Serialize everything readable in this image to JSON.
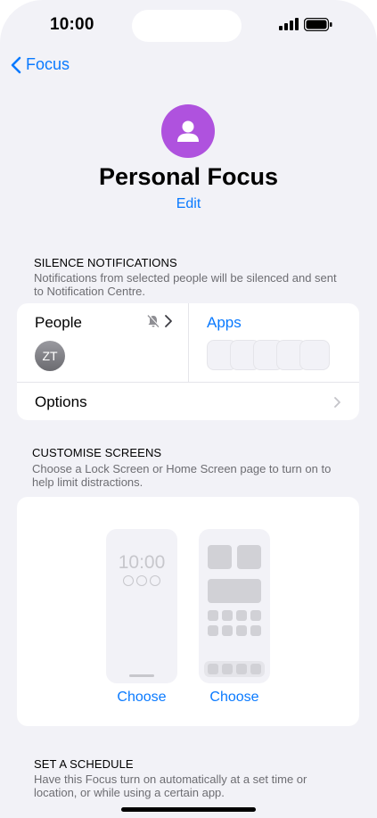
{
  "status_bar": {
    "time": "10:00"
  },
  "nav": {
    "back_label": "Focus"
  },
  "focus": {
    "title": "Personal Focus",
    "edit_label": "Edit",
    "icon_color": "#af52de"
  },
  "silence": {
    "header": "SILENCE NOTIFICATIONS",
    "description": "Notifications from selected people will be silenced and sent to Notification Centre.",
    "people_label": "People",
    "avatar_initials": "ZT",
    "apps_label": "Apps",
    "options_label": "Options"
  },
  "customise": {
    "header": "CUSTOMISE SCREENS",
    "description": "Choose a Lock Screen or Home Screen page to turn on to help limit distractions.",
    "lock_time": "10:00",
    "lock_choose": "Choose",
    "home_choose": "Choose"
  },
  "schedule": {
    "header": "SET A SCHEDULE",
    "description": "Have this Focus turn on automatically at a set time or location, or while using a certain app."
  },
  "colors": {
    "accent": "#0a7aff",
    "background": "#f2f2f7"
  }
}
